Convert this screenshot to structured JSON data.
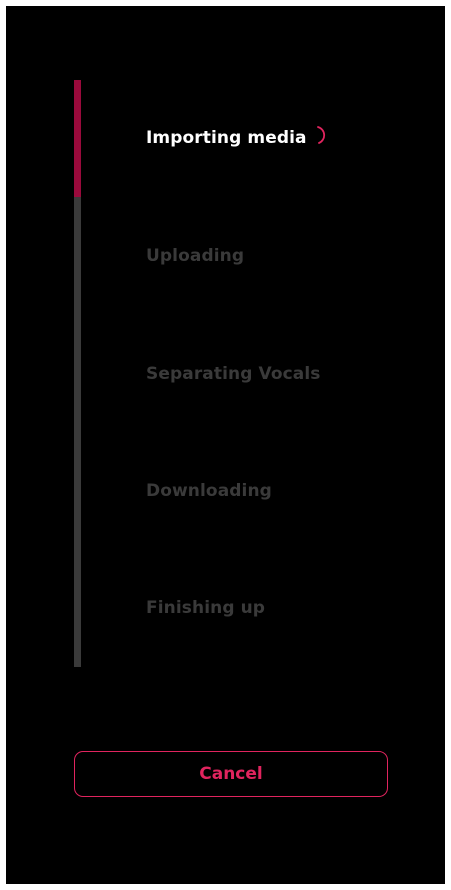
{
  "progress": {
    "fraction": 0.2,
    "fill_color": "#9a0a3c",
    "track_color": "#3a3a3a"
  },
  "steps": [
    {
      "label": "Importing media",
      "state": "active"
    },
    {
      "label": "Uploading",
      "state": "pending"
    },
    {
      "label": "Separating Vocals",
      "state": "pending"
    },
    {
      "label": "Downloading",
      "state": "pending"
    },
    {
      "label": "Finishing up",
      "state": "pending"
    }
  ],
  "spinner_icon": "loading-spinner-icon",
  "cancel_button": {
    "label": "Cancel",
    "color": "#e0245e"
  }
}
